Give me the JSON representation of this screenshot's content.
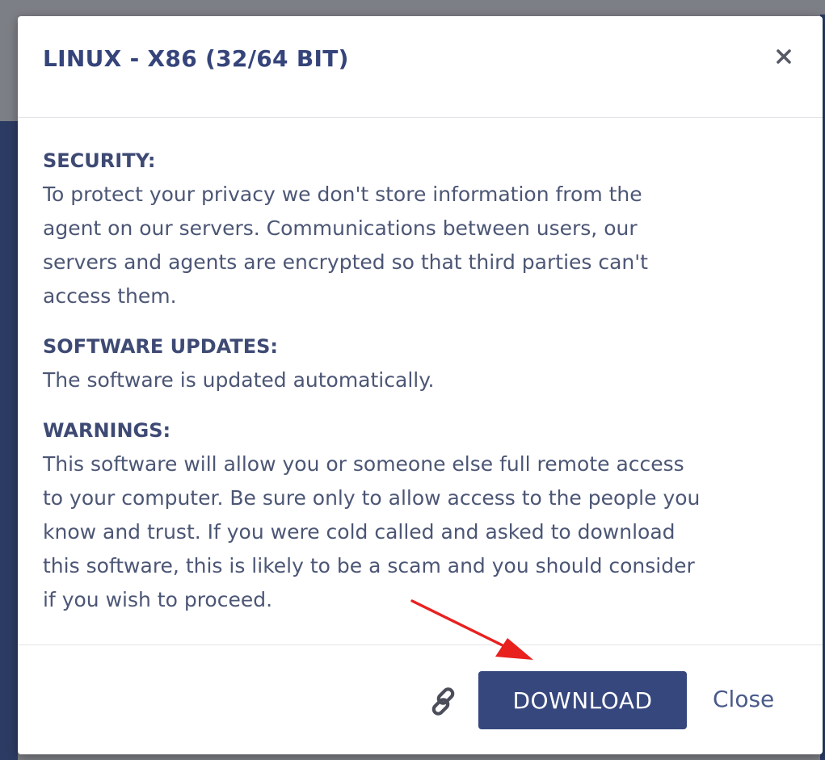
{
  "modal": {
    "title": "LINUX - X86 (32/64 BIT)",
    "close_icon": "close-x-icon"
  },
  "sections": [
    {
      "heading": "SECURITY:",
      "lines": [
        "To protect your privacy we don't store information from the",
        "agent on our servers. Communications between users, our",
        "servers and agents are encrypted so that third parties can't",
        "access them."
      ]
    },
    {
      "heading": "SOFTWARE UPDATES:",
      "lines": [
        "The software is updated automatically."
      ]
    },
    {
      "heading": "WARNINGS:",
      "lines": [
        "This software will allow you or someone else full remote access",
        "to your computer. Be sure only to allow access to the people you",
        "know and trust. If you were cold called and asked to download",
        "this software, this is likely to be a scam and you should consider",
        "if you wish to proceed."
      ]
    }
  ],
  "footer": {
    "link_icon": "link-icon",
    "download_label": "DOWNLOAD",
    "close_label": "Close"
  },
  "colors": {
    "primary": "#36477e",
    "title": "#35447a",
    "body_text": "#4c5675",
    "annotation_arrow": "#e8211f"
  }
}
